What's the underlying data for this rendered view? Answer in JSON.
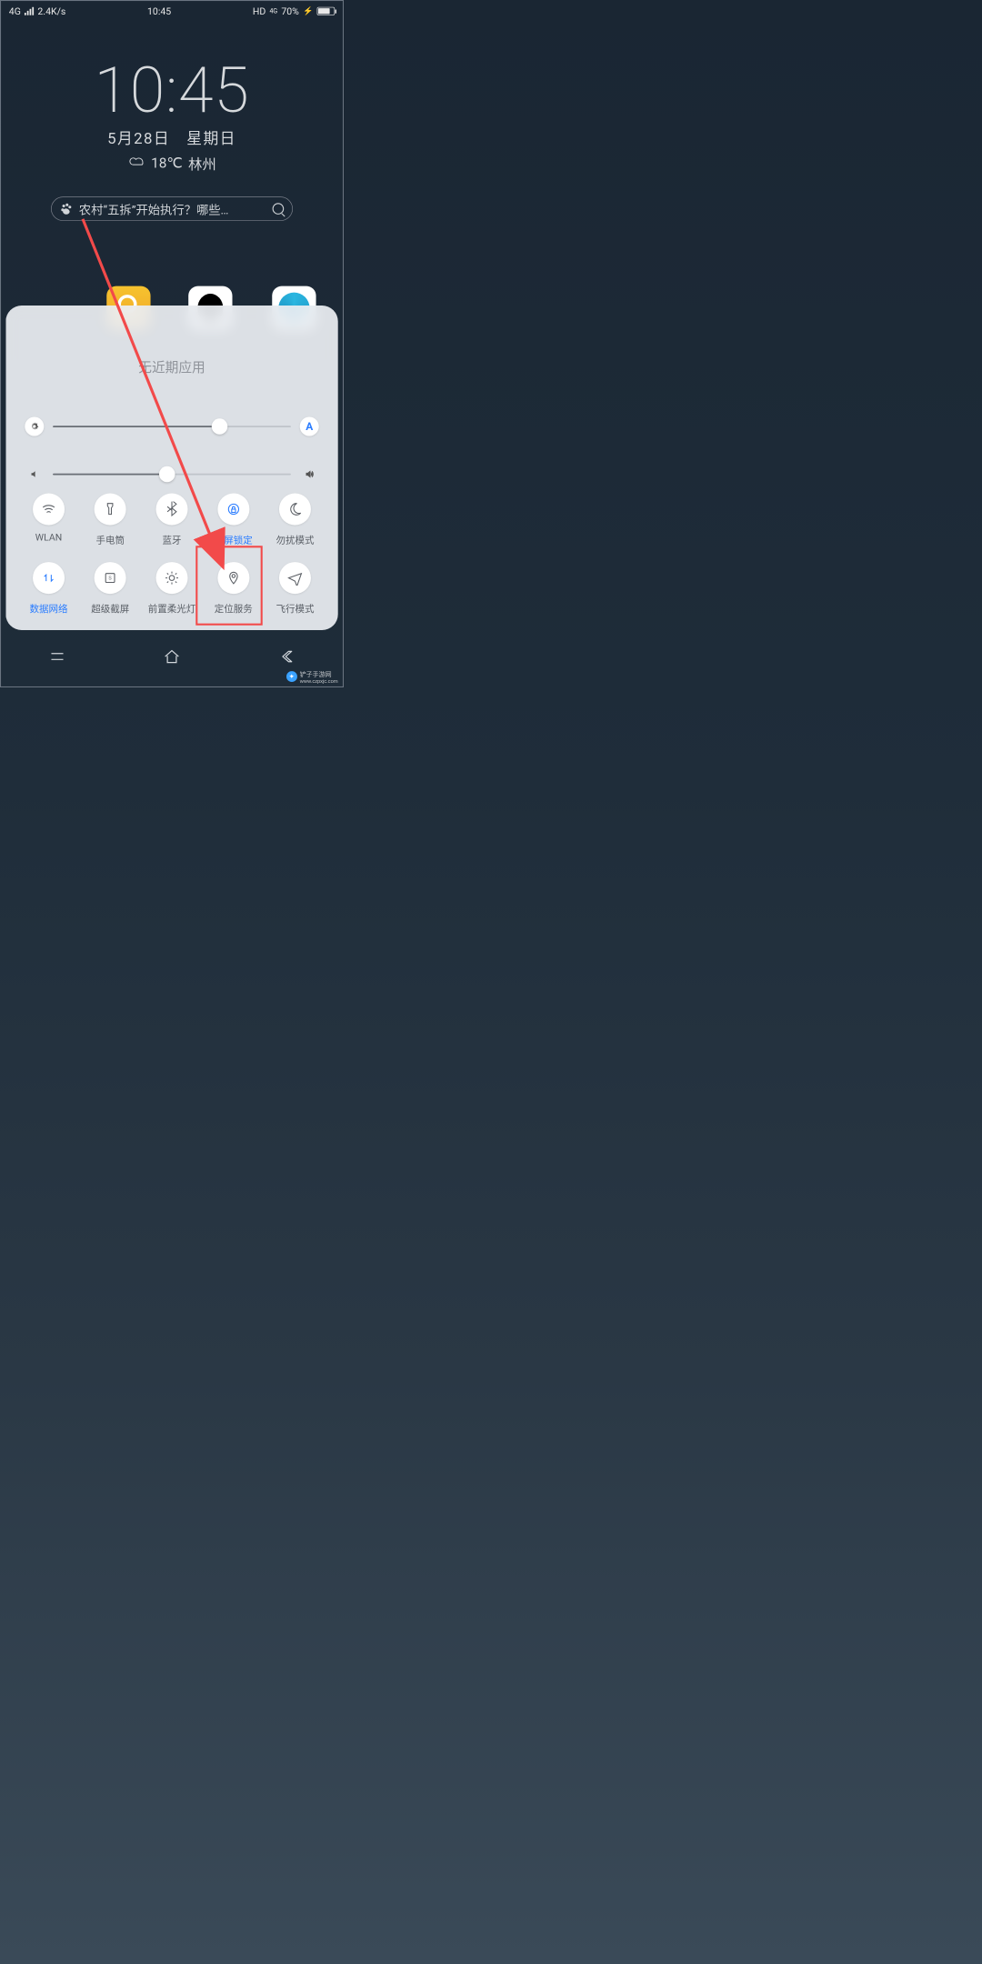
{
  "status": {
    "network_type": "4G",
    "speed": "2.4K/s",
    "time_small": "10:45",
    "hd": "HD",
    "net_small": "4G",
    "battery_pct": "70%"
  },
  "lock": {
    "time": "10:45",
    "date": "5月28日　星期日",
    "temp": "18℃",
    "city": "林州"
  },
  "search": {
    "placeholder": "农村“五拆”开始执行？哪些…"
  },
  "panel": {
    "no_recent": "无近期应用",
    "brightness_pct": 70,
    "auto_label": "A",
    "volume_pct": 48
  },
  "toggles": {
    "row1": [
      {
        "id": "wifi",
        "label": "WLAN",
        "on": false
      },
      {
        "id": "torch",
        "label": "手电筒",
        "on": false
      },
      {
        "id": "bt",
        "label": "蓝牙",
        "on": false
      },
      {
        "id": "rotate",
        "label": "竖屏锁定",
        "on": true
      },
      {
        "id": "dnd",
        "label": "勿扰模式",
        "on": false
      }
    ],
    "row2": [
      {
        "id": "data",
        "label": "数据网络",
        "on": true
      },
      {
        "id": "shot",
        "label": "超级截屏",
        "on": false
      },
      {
        "id": "flash",
        "label": "前置柔光灯",
        "on": false
      },
      {
        "id": "loc",
        "label": "定位服务",
        "on": false
      },
      {
        "id": "air",
        "label": "飞行模式",
        "on": false
      }
    ]
  },
  "watermark": {
    "label": "铲子手游网",
    "url": "www.czpxjc.com"
  }
}
